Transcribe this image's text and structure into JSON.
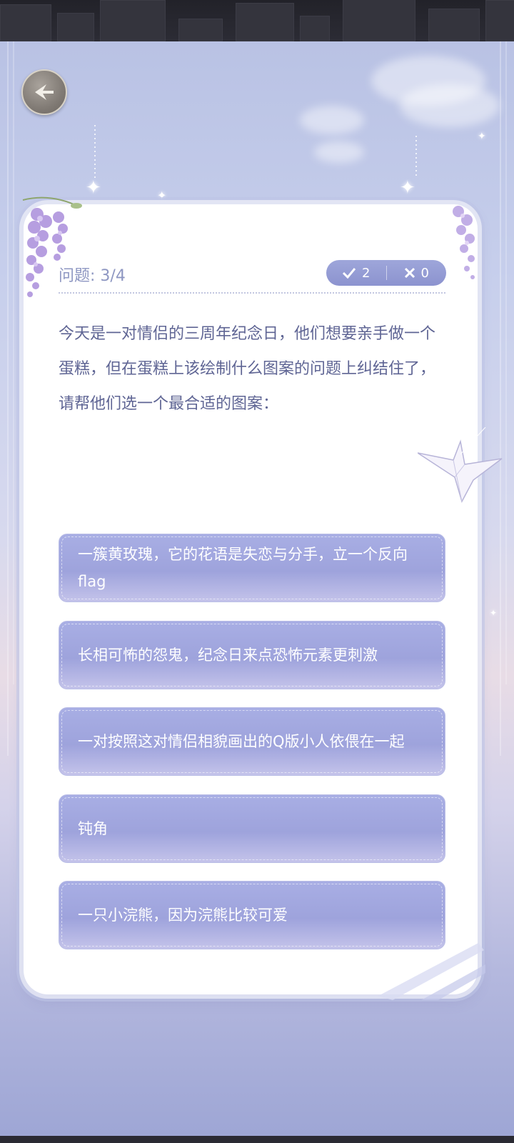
{
  "quiz": {
    "question_progress": "问题: 3/4",
    "correct_count": "2",
    "wrong_count": "0",
    "question_text": "今天是一对情侣的三周年纪念日，他们想要亲手做一个蛋糕，但在蛋糕上该绘制什么图案的问题上纠结住了，请帮他们选一个最合适的图案：",
    "options": [
      "一簇黄玫瑰，它的花语是失恋与分手，立一个反向flag",
      "长相可怖的怨鬼，纪念日来点恐怖元素更刺激",
      "一对按照这对情侣相貌画出的Q版小人依偎在一起",
      "钝角",
      "一只小浣熊，因为浣熊比较可爱"
    ]
  },
  "icons": {
    "back": "back-arrow-icon",
    "correct": "check-icon",
    "wrong": "cross-icon"
  },
  "colors": {
    "option_bg": "#a2a8df",
    "score_badge": "#959dd5",
    "question_text": "#5f6594",
    "progress_text": "#8e97c2"
  }
}
